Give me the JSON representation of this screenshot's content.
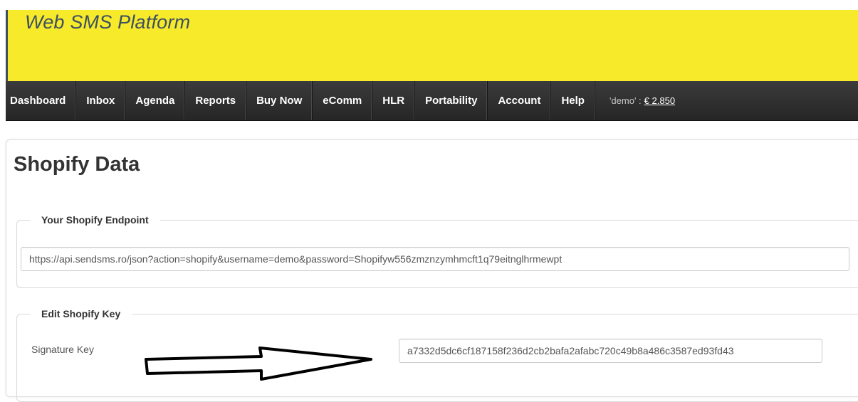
{
  "header": {
    "title": "Web SMS Platform",
    "background_color": "#f7ea2a"
  },
  "navbar": {
    "items": [
      {
        "label": "Dashboard"
      },
      {
        "label": "Inbox"
      },
      {
        "label": "Agenda"
      },
      {
        "label": "Reports"
      },
      {
        "label": "Buy Now"
      },
      {
        "label": "eComm"
      },
      {
        "label": "HLR"
      },
      {
        "label": "Portability"
      },
      {
        "label": "Account"
      },
      {
        "label": "Help"
      }
    ],
    "balance_prefix": "'demo' :",
    "balance_amount": "€ 2.850"
  },
  "main": {
    "title": "Shopify Data",
    "endpoint_section": {
      "legend": "Your Shopify Endpoint",
      "value": "https://api.sendsms.ro/json?action=shopify&username=demo&password=Shopifyw556zmznzymhmcft1q79eitnglhrmewpt"
    },
    "key_section": {
      "legend": "Edit Shopify Key",
      "label": "Signature Key",
      "value": "a7332d5dc6cf187158f236d2cb2bafa2afabc720c49b8a486c3587ed93fd43",
      "annotation_icon": "arrow-right-icon"
    }
  }
}
